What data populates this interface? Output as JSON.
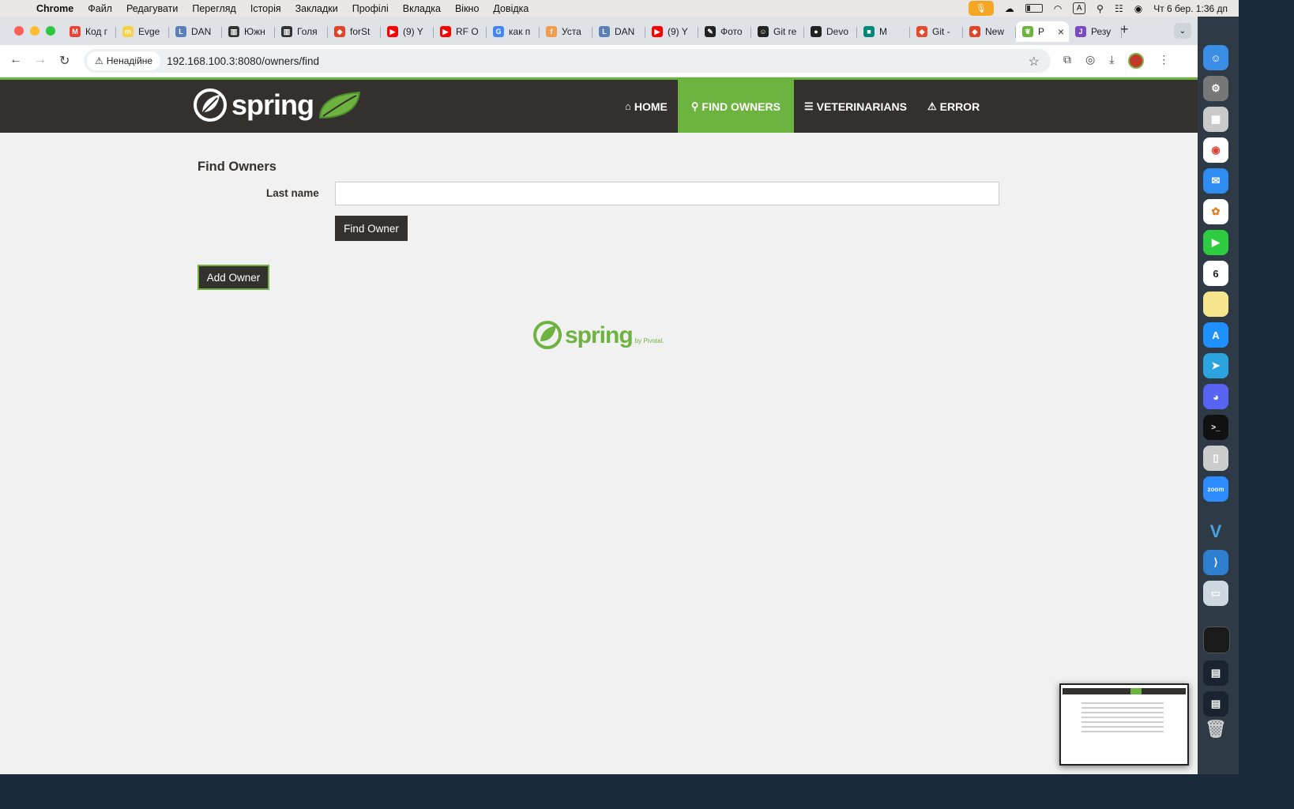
{
  "menubar": {
    "app": "Chrome",
    "items": [
      "Файл",
      "Редагувати",
      "Перегляд",
      "Історія",
      "Закладки",
      "Профілі",
      "Вкладка",
      "Вікно",
      "Довідка"
    ],
    "clock": "Чт 6 бер.  1:36 дп",
    "input_indicator": "A"
  },
  "browser": {
    "tabs": [
      {
        "label": "Код г",
        "icon": "gmail-icon",
        "color": "#ea4335",
        "glyph": "M"
      },
      {
        "label": "Evge",
        "icon": "miro-icon",
        "color": "#f7d147",
        "glyph": "m"
      },
      {
        "label": "DAN",
        "icon": "document-icon",
        "color": "#5b7fb8",
        "glyph": "L"
      },
      {
        "label": "Южн",
        "icon": "chart-icon",
        "color": "#333333",
        "glyph": "▥"
      },
      {
        "label": "Голя",
        "icon": "chart-icon",
        "color": "#333333",
        "glyph": "▥"
      },
      {
        "label": "forSt",
        "icon": "gitlab-icon",
        "color": "#e24329",
        "glyph": "◆"
      },
      {
        "label": "(9) Y",
        "icon": "youtube-icon",
        "color": "#ff0000",
        "glyph": "▶"
      },
      {
        "label": "RF O",
        "icon": "youtube-icon",
        "color": "#ff0000",
        "glyph": "▶"
      },
      {
        "label": "как п",
        "icon": "google-icon",
        "color": "#4285f4",
        "glyph": "G"
      },
      {
        "label": "Уста",
        "icon": "orange-circle-icon",
        "color": "#f39c4a",
        "glyph": "f"
      },
      {
        "label": "DAN",
        "icon": "document-icon",
        "color": "#5b7fb8",
        "glyph": "L"
      },
      {
        "label": "(9) Y",
        "icon": "youtube-icon",
        "color": "#ff0000",
        "glyph": "▶"
      },
      {
        "label": "Фото",
        "icon": "pin-icon",
        "color": "#222222",
        "glyph": "✎"
      },
      {
        "label": "Git re",
        "icon": "copilot-icon",
        "color": "#222222",
        "glyph": "☺"
      },
      {
        "label": "Devo",
        "icon": "github-icon",
        "color": "#222222",
        "glyph": "●"
      },
      {
        "label": "M",
        "icon": "meet-icon",
        "color": "#00897b",
        "glyph": "■"
      },
      {
        "label": "Git -",
        "icon": "git-icon",
        "color": "#e44c30",
        "glyph": "◆"
      },
      {
        "label": "New",
        "icon": "gitlab-icon",
        "color": "#e24329",
        "glyph": "◆"
      },
      {
        "label": "P",
        "icon": "spring-leaf-icon",
        "color": "#6db33f",
        "glyph": "❦"
      },
      {
        "label": "Резу",
        "icon": "jpg-icon",
        "color": "#7b4bc4",
        "glyph": "J"
      }
    ],
    "security_chip": "Ненадійне",
    "url": "192.168.100.3:8080/owners/find"
  },
  "app": {
    "brand": "spring",
    "nav": [
      {
        "label": "Home",
        "icon": "home-icon",
        "glyph": "⌂"
      },
      {
        "label": "Find owners",
        "icon": "search-icon",
        "glyph": "⚲"
      },
      {
        "label": "Veterinarians",
        "icon": "list-icon",
        "glyph": "☰"
      },
      {
        "label": "Error",
        "icon": "warning-icon",
        "glyph": "⚠"
      }
    ],
    "active_nav": "Find owners",
    "colors": {
      "brand_green": "#6db33f",
      "nav_dark": "#34302d"
    }
  },
  "form": {
    "title": "Find Owners",
    "last_name_label": "Last name",
    "last_name_value": "",
    "find_button": "Find Owner",
    "add_button": "Add Owner"
  },
  "footer": {
    "brand": "spring",
    "by": "by Pivotal."
  }
}
